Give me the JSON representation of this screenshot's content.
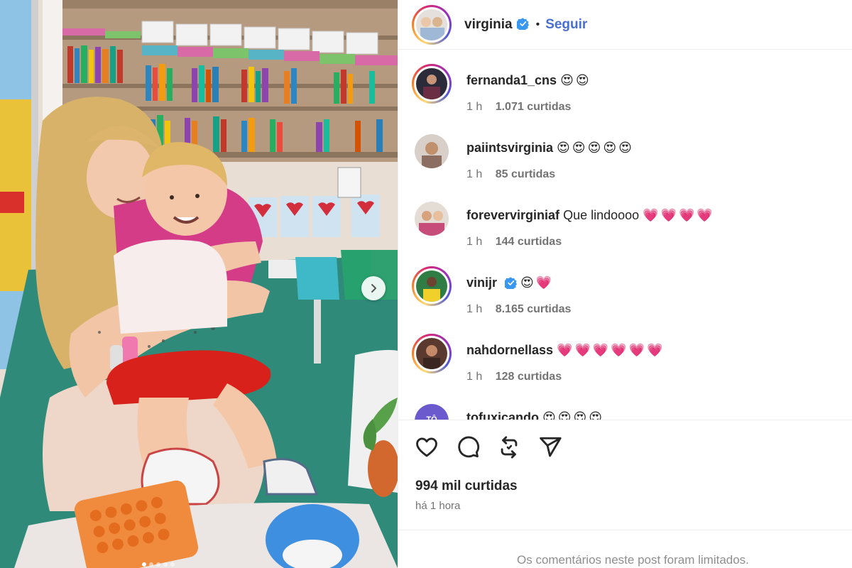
{
  "post": {
    "author": {
      "username": "virginia",
      "verified": true,
      "bullet": "•",
      "follow_label": "Seguir"
    },
    "carousel": {
      "slides": 5,
      "active": 0
    }
  },
  "comments": [
    {
      "username": "fernanda1_cns",
      "verified": false,
      "text": "",
      "emoji": "😍😍",
      "time": "1 h",
      "likes": "1.071 curtidas",
      "ring": "gradient"
    },
    {
      "username": "paiintsvirginia",
      "verified": false,
      "text": "",
      "emoji": "😍😍😍😍😍",
      "time": "1 h",
      "likes": "85 curtidas",
      "ring": "none"
    },
    {
      "username": "forevervirginiaf",
      "verified": false,
      "text": "Que lindoooo",
      "emoji": "💗💗💗💗",
      "time": "1 h",
      "likes": "144 curtidas",
      "ring": "none"
    },
    {
      "username": "vinijr",
      "verified": true,
      "text": "",
      "emoji": "😍💗",
      "time": "1 h",
      "likes": "8.165 curtidas",
      "ring": "gradient"
    },
    {
      "username": "nahdornellass",
      "verified": false,
      "text": "",
      "emoji": "💗💗💗💗💗💗",
      "time": "1 h",
      "likes": "128 curtidas",
      "ring": "gradient"
    },
    {
      "username": "tofuxicando",
      "verified": false,
      "text": "",
      "emoji": "😍😍😍😍",
      "time": "",
      "likes": "",
      "ring": "none",
      "avatar_text": "TÔ"
    }
  ],
  "actions": {
    "like_icon": "heart-icon",
    "comment_icon": "comment-bubble-icon",
    "repost_icon": "repost-icon",
    "share_icon": "send-icon"
  },
  "likes_total": "994 mil curtidas",
  "posted_ago": "há 1 hora",
  "comments_limited_notice": "Os comentários neste post foram limitados.",
  "colors": {
    "follow": "#4a6fd2",
    "verified": "#3897f0",
    "muted": "#737373"
  }
}
